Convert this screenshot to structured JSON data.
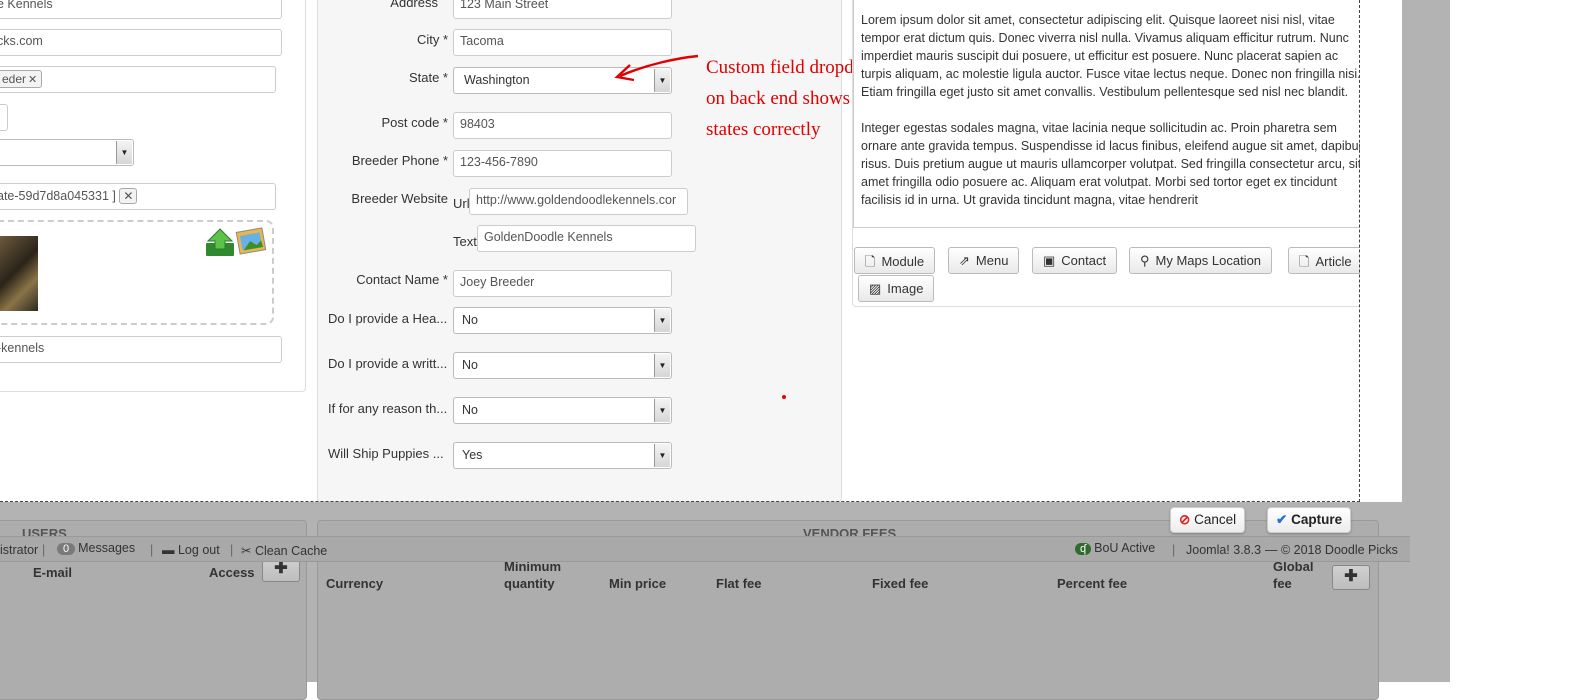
{
  "left": {
    "field1_value": "e Kennels",
    "field2_value": "cks.com",
    "chip1_label": "eder",
    "chip2_label": "ate-59d7d8a045331 ]",
    "alias_value": "-kennels"
  },
  "form": {
    "address_label": "Address",
    "address_value": "123 Main Street",
    "city_label": "City *",
    "city_value": "Tacoma",
    "state_label": "State *",
    "state_value": "Washington",
    "postcode_label": "Post code *",
    "postcode_value": "98403",
    "phone_label": "Breeder Phone *",
    "phone_value": "123-456-7890",
    "website_label": "Breeder Website",
    "url_label": "Url",
    "url_value": "http://www.goldendoodlekennels.cor",
    "text_label": "Text",
    "text_value": "GoldenDoodle Kennels",
    "contact_label": "Contact Name *",
    "contact_value": "Joey Breeder",
    "q1_label": "Do I provide a Hea...",
    "q1_value": "No",
    "q2_label": "Do I provide a writt...",
    "q2_value": "No",
    "q3_label": "If for any reason th...",
    "q3_value": "No",
    "q4_label": "Will Ship Puppies ...",
    "q4_value": "Yes"
  },
  "annotation": {
    "line1": "Custom field dropdown",
    "line2": "on back end shows",
    "line3": "states correctly",
    "color": "#e00000"
  },
  "editor": {
    "paragraph1": "Lorem ipsum dolor sit amet, consectetur adipiscing elit. Quisque laoreet nisi nisl, vitae tempor erat dictum quis. Donec viverra nisl nulla. Vivamus aliquam efficitur rutrum. Nunc imperdiet mauris suscipit dui posuere, ut efficitur est posuere. Nunc placerat sapien ac turpis aliquam, ac molestie ligula auctor. Fusce vitae lectus neque. Donec non fringilla nisi. Etiam fringilla eget justo sit amet convallis. Vestibulum pellentesque sed nisl nec blandit.",
    "paragraph2": "Integer egestas sodales magna, vitae lacinia neque sollicitudin ac. Proin pharetra sem ornare ante gravida tempus. Suspendisse id lacus finibus, eleifend augue sit amet, dapibus risus. Duis pretium augue ut mauris ullamcorper volutpat. Sed fringilla consectetur arcu, sit amet fringilla odio posuere ac. Aliquam erat volutpat. Morbi sed tortor eget ex tincidunt facilisis id in urna. Ut gravida tincidunt magna, vitae hendrerit",
    "buttons": {
      "module": "Module",
      "menu": "Menu",
      "contact": "Contact",
      "maps": "My Maps Location",
      "article": "Article",
      "image": "Image"
    }
  },
  "capture": {
    "cancel_label": "Cancel",
    "capture_label": "Capture"
  },
  "users_section": {
    "title": "USERS",
    "email_header": "E-mail",
    "access_header": "Access"
  },
  "status_bar": {
    "admin_text": "istrator",
    "messages_count": "0",
    "messages_label": "Messages",
    "logout_label": "Log out",
    "clean_cache_label": "Clean Cache",
    "bou_label": "BoU Active",
    "version_text": "Joomla! 3.8.3",
    "copyright_text": "— © 2018 Doodle Picks"
  },
  "vendor_fees": {
    "title": "VENDOR FEES",
    "columns": {
      "currency": "Currency",
      "min_qty_line1": "Minimum",
      "min_qty_line2": "quantity",
      "min_price": "Min price",
      "flat_fee": "Flat fee",
      "fixed_fee": "Fixed fee",
      "percent_fee": "Percent fee",
      "global_line1": "Global",
      "global_line2": "fee"
    }
  }
}
